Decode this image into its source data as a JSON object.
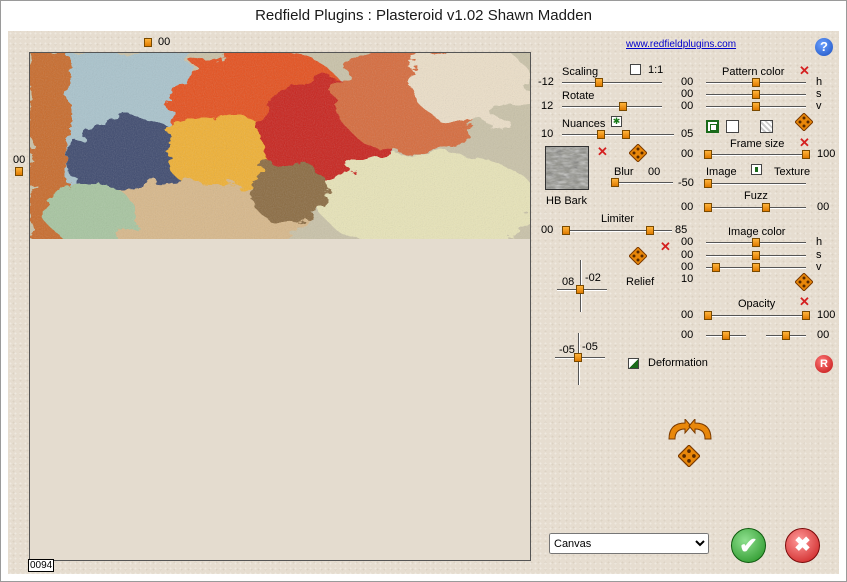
{
  "window": {
    "title": "Redfield Plugins : Plasteroid v1.02   Shawn Madden"
  },
  "preview": {
    "top_value": "00",
    "left_value": "00",
    "counter": "0094"
  },
  "header": {
    "link": "www.redfieldplugins.com",
    "help_icon": "question-mark-icon"
  },
  "scaling": {
    "label": "Scaling",
    "value": "-12",
    "ratio_label": "1:1",
    "level": 0.47
  },
  "rotate": {
    "label": "Rotate",
    "value": "12",
    "level": 0.6
  },
  "nuances": {
    "label": "Nuances",
    "left_value": "10",
    "right_value": "05",
    "thumb1": 0.42,
    "thumb2": 0.62
  },
  "texture": {
    "name": "HB Bark"
  },
  "blur": {
    "label": "Blur",
    "value": "00",
    "level": 0.05
  },
  "limiter": {
    "label": "Limiter",
    "left_value": "00",
    "right_value": "85",
    "thumb1": 0.04,
    "thumb2": 0.85
  },
  "relief": {
    "label": "Relief",
    "x_value": "08",
    "y_value": "-02"
  },
  "deformation": {
    "label": "Deformation",
    "x_value": "-05",
    "y_value": "-05"
  },
  "pattern_color": {
    "label": "Pattern color",
    "h": "00",
    "s": "00",
    "v": "00",
    "h_label": "h",
    "s_label": "s",
    "v_label": "v"
  },
  "frame_size": {
    "label": "Frame size",
    "left_value": "00",
    "right_value": "100"
  },
  "image_texture": {
    "image_label": "Image",
    "texture_label": "Texture",
    "value": "-50"
  },
  "fuzz": {
    "label": "Fuzz",
    "left_value": "00",
    "right_value": "00"
  },
  "image_color": {
    "label": "Image color",
    "h": "00",
    "s": "00",
    "v": "00",
    "extra": "10",
    "h_label": "h",
    "s_label": "s",
    "v_label": "v"
  },
  "opacity": {
    "label": "Opacity",
    "left_value": "00",
    "right_value": "100",
    "bottom_left": "00",
    "bottom_right": "00"
  },
  "footer": {
    "mode_options": [
      "Canvas"
    ],
    "mode_selected": "Canvas",
    "reset_label": "R"
  },
  "colors": {
    "accent": "#e8870a",
    "ok": "#2aa52a",
    "cancel": "#d42020",
    "link": "#0000cc"
  }
}
